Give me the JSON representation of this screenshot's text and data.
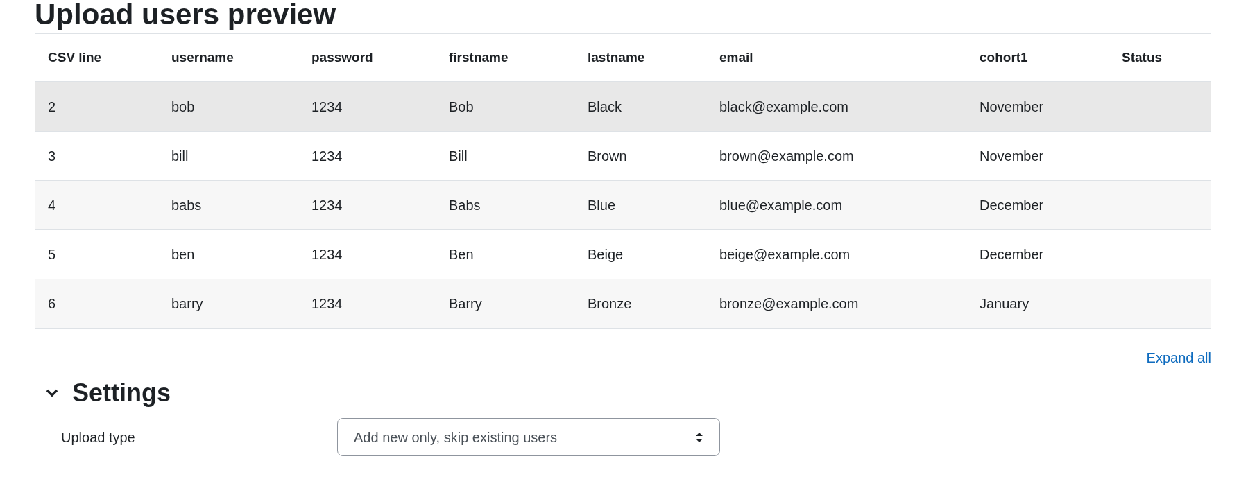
{
  "title": "Upload users preview",
  "table": {
    "columns": [
      "CSV line",
      "username",
      "password",
      "firstname",
      "lastname",
      "email",
      "cohort1",
      "Status"
    ],
    "rows": [
      {
        "cells": [
          "2",
          "bob",
          "1234",
          "Bob",
          "Black",
          "black@example.com",
          "November",
          ""
        ],
        "hovered": true
      },
      {
        "cells": [
          "3",
          "bill",
          "1234",
          "Bill",
          "Brown",
          "brown@example.com",
          "November",
          ""
        ],
        "hovered": false
      },
      {
        "cells": [
          "4",
          "babs",
          "1234",
          "Babs",
          "Blue",
          "blue@example.com",
          "December",
          ""
        ],
        "hovered": false
      },
      {
        "cells": [
          "5",
          "ben",
          "1234",
          "Ben",
          "Beige",
          "beige@example.com",
          "December",
          ""
        ],
        "hovered": false
      },
      {
        "cells": [
          "6",
          "barry",
          "1234",
          "Barry",
          "Bronze",
          "bronze@example.com",
          "January",
          ""
        ],
        "hovered": false
      }
    ]
  },
  "expand_all_link": "Expand all",
  "settings": {
    "title": "Settings",
    "expanded": true,
    "fields": [
      {
        "label": "Upload type",
        "value": "Add new only, skip existing users"
      }
    ]
  }
}
